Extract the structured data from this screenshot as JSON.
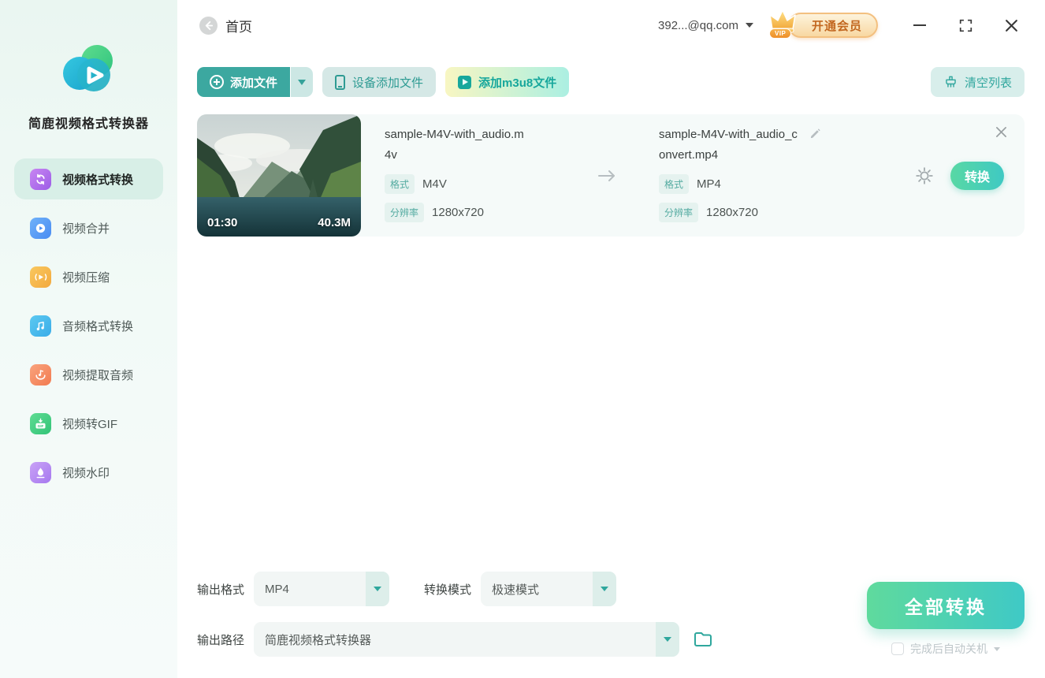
{
  "app_title": "简鹿视频格式转换器",
  "header": {
    "home": "首页",
    "account": "392...@qq.com",
    "vip_text": "开通会员",
    "vip_tag": "VIP"
  },
  "sidebar": {
    "items": [
      {
        "label": "视频格式转换",
        "active": true
      },
      {
        "label": "视频合并",
        "active": false
      },
      {
        "label": "视频压缩",
        "active": false
      },
      {
        "label": "音频格式转换",
        "active": false
      },
      {
        "label": "视频提取音频",
        "active": false
      },
      {
        "label": "视频转GIF",
        "active": false
      },
      {
        "label": "视频水印",
        "active": false
      }
    ]
  },
  "toolbar": {
    "add_file": "添加文件",
    "device_add": "设备添加文件",
    "add_m3u8": "添加m3u8文件",
    "clear_list": "清空列表"
  },
  "file_item": {
    "duration": "01:30",
    "size": "40.3M",
    "source": {
      "name": "sample-M4V-with_audio.m4v",
      "format_label": "格式",
      "format": "M4V",
      "resolution_label": "分辨率",
      "resolution": "1280x720"
    },
    "output": {
      "name": "sample-M4V-with_audio_convert.mp4",
      "format_label": "格式",
      "format": "MP4",
      "resolution_label": "分辨率",
      "resolution": "1280x720"
    },
    "convert_button": "转换"
  },
  "footer": {
    "output_format_label": "输出格式",
    "output_format_value": "MP4",
    "convert_mode_label": "转换模式",
    "convert_mode_value": "极速模式",
    "output_path_label": "输出路径",
    "output_path_value": "简鹿视频格式转换器",
    "convert_all": "全部转换",
    "auto_shutdown": "完成后自动关机"
  },
  "colors": {
    "accent_teal": "#3CA8A0",
    "light_teal_bg": "#D8EEEB",
    "sidebar_active_bg": "#D8EFE7",
    "cta_gradient_start": "#5FDA9D",
    "cta_gradient_end": "#3FC9C6",
    "badge_bg": "#E5F2EF",
    "badge_text": "#54ABA1",
    "vip_text_color": "#C2671F"
  }
}
